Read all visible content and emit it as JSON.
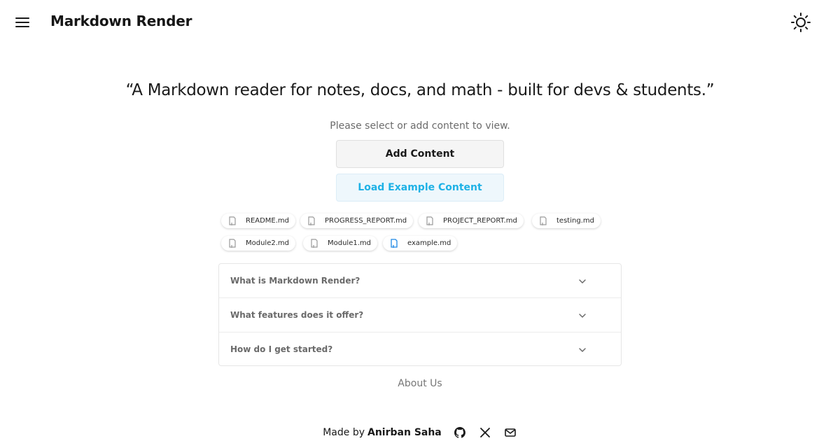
{
  "header": {
    "title": "Markdown Render",
    "menu_icon": "hamburger-menu-icon",
    "theme_icon": "sun-icon"
  },
  "hero": {
    "tagline": "“A Markdown reader for notes, docs, and math - built for devs & students.”",
    "subtitle": "Please select or add content to view."
  },
  "actions": {
    "add_label": "Add Content",
    "load_label": "Load Example Content"
  },
  "files": [
    {
      "name": "README.md",
      "selected": false
    },
    {
      "name": "PROGRESS_REPORT.md",
      "selected": false
    },
    {
      "name": "PROJECT_REPORT.md",
      "selected": false
    },
    {
      "name": "testing.md",
      "selected": false
    },
    {
      "name": "Module2.md",
      "selected": false
    },
    {
      "name": "Module1.md",
      "selected": false
    },
    {
      "name": "example.md",
      "selected": true
    }
  ],
  "faq": [
    {
      "question": "What is Markdown Render?"
    },
    {
      "question": "What features does it offer?"
    },
    {
      "question": "How do I get started?"
    }
  ],
  "about_label": "About Us",
  "footer": {
    "made_by": "Made by",
    "author": "Anirban Saha",
    "icons": [
      "github-icon",
      "x-icon",
      "mail-icon"
    ]
  },
  "colors": {
    "accent": "#1fb2e6",
    "selected_file_icon": "#1e88e5",
    "file_icon": "#9a9a9a"
  }
}
